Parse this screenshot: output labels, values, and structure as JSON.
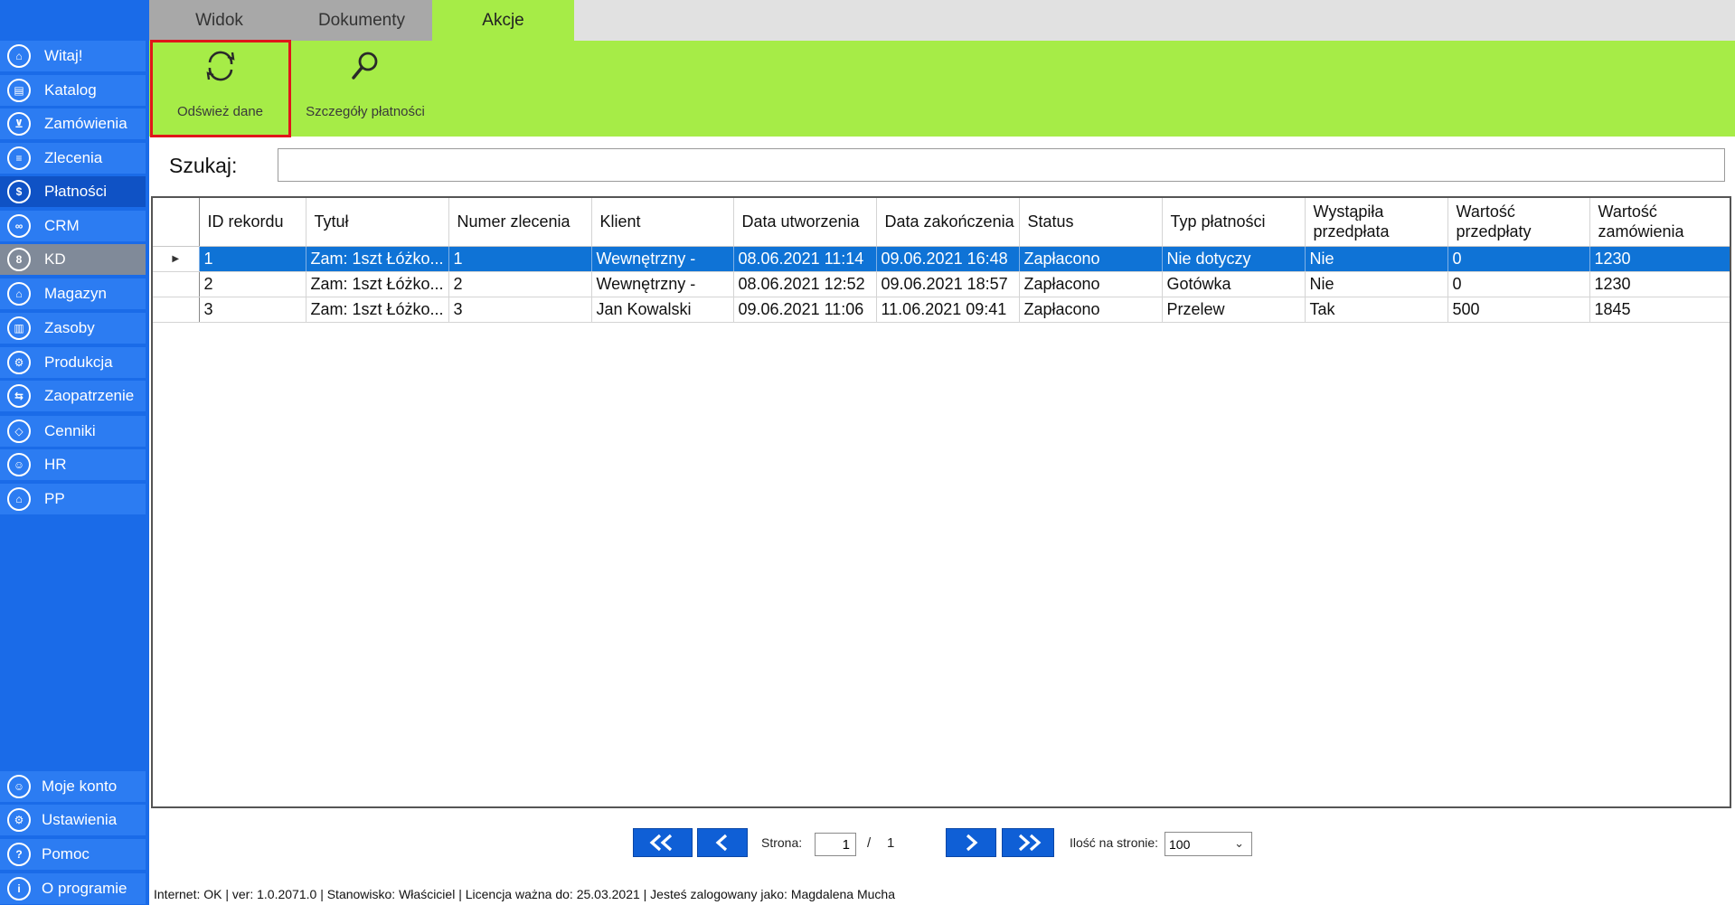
{
  "tabs": [
    {
      "label": "Widok"
    },
    {
      "label": "Dokumenty"
    },
    {
      "label": "Akcje"
    }
  ],
  "ribbon": {
    "refresh_label": "Odśwież dane",
    "details_label": "Szczegóły płatności"
  },
  "sidebar": {
    "items": [
      {
        "label": "Witaj!",
        "icon": "home-icon"
      },
      {
        "label": "Katalog",
        "icon": "book-icon"
      },
      {
        "label": "Zamówienia",
        "icon": "cart-icon"
      },
      {
        "label": "Zlecenia",
        "icon": "list-icon"
      },
      {
        "label": "Płatności",
        "icon": "dollar-icon"
      },
      {
        "label": "CRM",
        "icon": "crm-icon"
      },
      {
        "label": "KD",
        "icon": "lock-icon"
      },
      {
        "label": "Magazyn",
        "icon": "warehouse-icon"
      },
      {
        "label": "Zasoby",
        "icon": "resources-icon"
      },
      {
        "label": "Produkcja",
        "icon": "production-icon"
      },
      {
        "label": "Zaopatrzenie",
        "icon": "truck-icon"
      },
      {
        "label": "Cenniki",
        "icon": "tag-icon"
      },
      {
        "label": "HR",
        "icon": "hr-icon"
      },
      {
        "label": "PP",
        "icon": "pp-icon"
      }
    ],
    "bottom": [
      {
        "label": "Moje konto",
        "icon": "user-icon"
      },
      {
        "label": "Ustawienia",
        "icon": "gear-icon"
      },
      {
        "label": "Pomoc",
        "icon": "help-icon"
      },
      {
        "label": "O programie",
        "icon": "info-icon"
      }
    ]
  },
  "search": {
    "label": "Szukaj:",
    "value": ""
  },
  "grid": {
    "columns": [
      "ID rekordu",
      "Tytuł",
      "Numer zlecenia",
      "Klient",
      "Data utworzenia",
      "Data zakończenia",
      "Status",
      "Typ płatności",
      "Wystąpiła przedpłata",
      "Wartość przedpłaty",
      "Wartość zamówienia"
    ],
    "rows": [
      [
        "1",
        "Zam: 1szt Łóżko...",
        "1",
        "Wewnętrzny -",
        "08.06.2021 11:14",
        "09.06.2021 16:48",
        "Zapłacono",
        "Nie dotyczy",
        "Nie",
        "0",
        "1230"
      ],
      [
        "2",
        "Zam: 1szt Łóżko...",
        "2",
        "Wewnętrzny -",
        "08.06.2021 12:52",
        "09.06.2021 18:57",
        "Zapłacono",
        "Gotówka",
        "Nie",
        "0",
        "1230"
      ],
      [
        "3",
        "Zam: 1szt Łóżko...",
        "3",
        "Jan Kowalski",
        "09.06.2021 11:06",
        "11.06.2021 09:41",
        "Zapłacono",
        "Przelew",
        "Tak",
        "500",
        "1845"
      ]
    ]
  },
  "pager": {
    "page_label": "Strona:",
    "current_page": "1",
    "separator": "/",
    "total_pages": "1",
    "per_page_label": "Ilość na stronie:",
    "per_page_value": "100"
  },
  "status": {
    "text": "Internet: OK  |   ver: 1.0.2071.0   |   Stanowisko: Właściciel    |   Licencja ważna do: 25.03.2021   |   Jesteś zalogowany jako: Magdalena Mucha"
  },
  "colors": {
    "sidebar": "#1a6be8",
    "ribbon": "#a6ec47",
    "selection": "#0f73d6",
    "highlight": "#e0151a"
  }
}
